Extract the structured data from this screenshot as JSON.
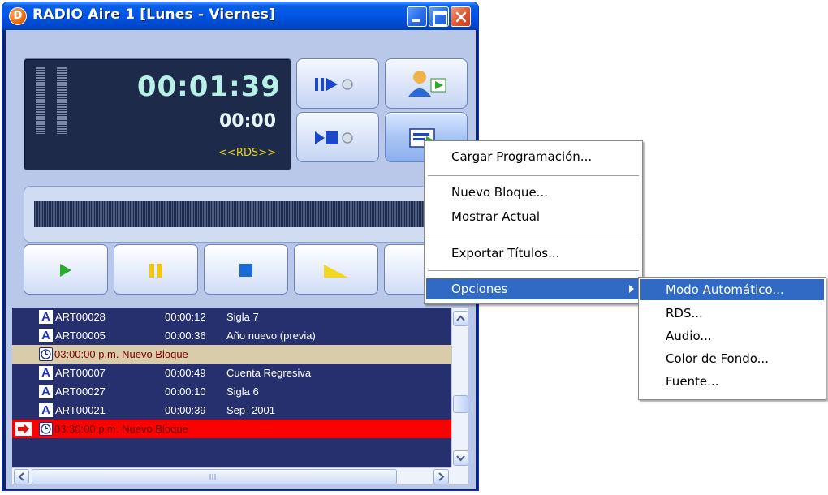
{
  "window": {
    "title": "RADIO Aire 1 [Lunes - Viernes]",
    "app_icon_letter": "D"
  },
  "display": {
    "time_main": "00:01:39",
    "time_sub": "00:00",
    "rds": "<<RDS>>"
  },
  "playlist": {
    "rows": [
      {
        "type": "item",
        "code": "ART00028",
        "duration": "00:00:12",
        "title": "Sigla 7"
      },
      {
        "type": "item",
        "code": "ART00005",
        "duration": "00:00:36",
        "title": "Año nuevo (previa)"
      },
      {
        "type": "block",
        "text": "03:00:00 p.m. Nuevo Bloque"
      },
      {
        "type": "item",
        "code": "ART00007",
        "duration": "00:00:49",
        "title": "Cuenta Regresiva"
      },
      {
        "type": "item",
        "code": "ART00027",
        "duration": "00:00:10",
        "title": "Sigla 6"
      },
      {
        "type": "item",
        "code": "ART00021",
        "duration": "00:00:39",
        "title": "Sep- 2001"
      },
      {
        "type": "block-current",
        "text": "03:30:00 p.m. Nuevo Bloque"
      }
    ]
  },
  "context_menu": {
    "items": [
      "Cargar Programación...",
      "Nuevo Bloque...",
      "Mostrar Actual",
      "Exportar Títulos...",
      "Opciones"
    ]
  },
  "submenu": {
    "items": [
      "Modo Automático...",
      "RDS...",
      "Audio...",
      "Color de Fondo...",
      "Fuente..."
    ]
  },
  "colors": {
    "titlebar": "#0055e5",
    "menu_highlight": "#316ac5",
    "playlist_bg": "#26306e",
    "block_row": "#d9ccaa",
    "current_row": "#ff0000",
    "rds_text": "#e8d020"
  }
}
